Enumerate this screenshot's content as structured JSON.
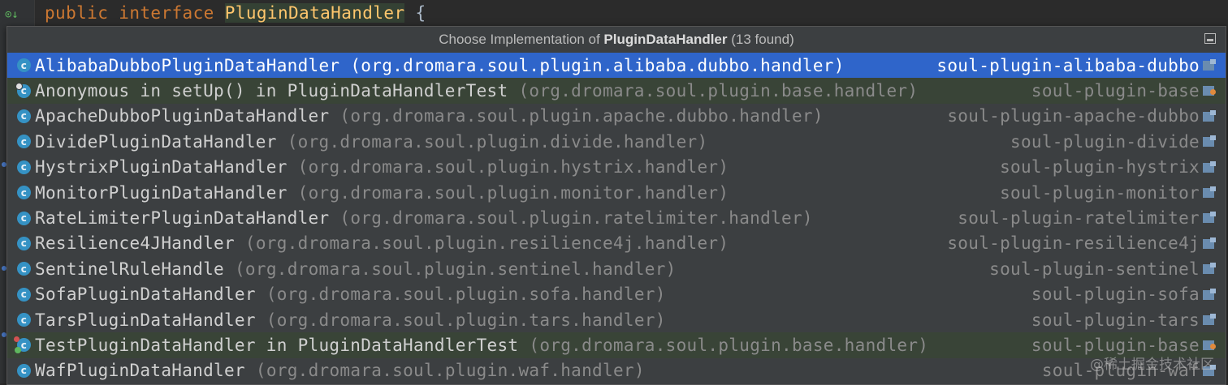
{
  "editor": {
    "code_keywords": "public interface",
    "code_class": "PluginDataHandler",
    "code_brace": "{",
    "code_prev": "*/"
  },
  "popup": {
    "title_prefix": "Choose Implementation of",
    "title_class": "PluginDataHandler",
    "title_count": "(13 found)"
  },
  "items": [
    {
      "name": "AlibabaDubboPluginDataHandler",
      "package": "(org.dromara.soul.plugin.alibaba.dubbo.handler)",
      "module": "soul-plugin-alibaba-dubbo",
      "kind": "class",
      "selected": true
    },
    {
      "name": "Anonymous in setUp() in PluginDataHandlerTest",
      "package": "(org.dromara.soul.plugin.base.handler)",
      "module": "soul-plugin-base",
      "kind": "anonymous",
      "test": true
    },
    {
      "name": "ApacheDubboPluginDataHandler",
      "package": "(org.dromara.soul.plugin.apache.dubbo.handler)",
      "module": "soul-plugin-apache-dubbo",
      "kind": "class"
    },
    {
      "name": "DividePluginDataHandler",
      "package": "(org.dromara.soul.plugin.divide.handler)",
      "module": "soul-plugin-divide",
      "kind": "class"
    },
    {
      "name": "HystrixPluginDataHandler",
      "package": "(org.dromara.soul.plugin.hystrix.handler)",
      "module": "soul-plugin-hystrix",
      "kind": "class"
    },
    {
      "name": "MonitorPluginDataHandler",
      "package": "(org.dromara.soul.plugin.monitor.handler)",
      "module": "soul-plugin-monitor",
      "kind": "class"
    },
    {
      "name": "RateLimiterPluginDataHandler",
      "package": "(org.dromara.soul.plugin.ratelimiter.handler)",
      "module": "soul-plugin-ratelimiter",
      "kind": "class"
    },
    {
      "name": "Resilience4JHandler",
      "package": "(org.dromara.soul.plugin.resilience4j.handler)",
      "module": "soul-plugin-resilience4j",
      "kind": "class"
    },
    {
      "name": "SentinelRuleHandle",
      "package": "(org.dromara.soul.plugin.sentinel.handler)",
      "module": "soul-plugin-sentinel",
      "kind": "class"
    },
    {
      "name": "SofaPluginDataHandler",
      "package": "(org.dromara.soul.plugin.sofa.handler)",
      "module": "soul-plugin-sofa",
      "kind": "class"
    },
    {
      "name": "TarsPluginDataHandler",
      "package": "(org.dromara.soul.plugin.tars.handler)",
      "module": "soul-plugin-tars",
      "kind": "class"
    },
    {
      "name": "TestPluginDataHandler in PluginDataHandlerTest",
      "package": "(org.dromara.soul.plugin.base.handler)",
      "module": "soul-plugin-base",
      "kind": "test-class",
      "test": true
    },
    {
      "name": "WafPluginDataHandler",
      "package": "(org.dromara.soul.plugin.waf.handler)",
      "module": "soul-plugin-waf",
      "kind": "class"
    }
  ],
  "icon_letter": "c",
  "watermark": "@稀土掘金技术社区",
  "colors": {
    "selection": "#2f65ca",
    "test_row": "#394437",
    "class_icon": "#3592c4"
  }
}
